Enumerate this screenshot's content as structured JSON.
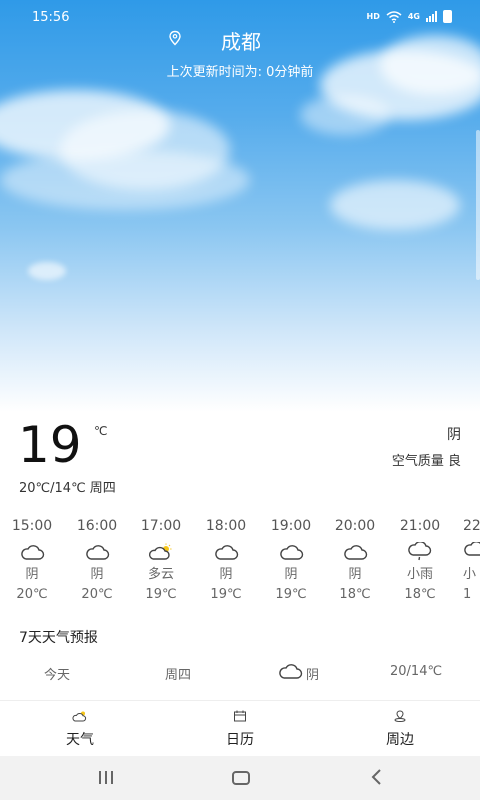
{
  "status": {
    "time": "15:56",
    "hd": "HD",
    "network": "4G"
  },
  "header": {
    "city": "成都",
    "updated": "上次更新时间为: 0分钟前"
  },
  "current": {
    "temp": "19",
    "unit": "℃",
    "condition": "阴",
    "aqi": "空气质量 良",
    "range_day": "20℃/14℃ 周四"
  },
  "hourly": [
    {
      "time": "15:00",
      "icon": "cloudy-icon",
      "cond": "阴",
      "temp": "20℃"
    },
    {
      "time": "16:00",
      "icon": "cloudy-icon",
      "cond": "阴",
      "temp": "20℃"
    },
    {
      "time": "17:00",
      "icon": "partly-cloudy-icon",
      "cond": "多云",
      "temp": "19℃"
    },
    {
      "time": "18:00",
      "icon": "cloudy-icon",
      "cond": "阴",
      "temp": "19℃"
    },
    {
      "time": "19:00",
      "icon": "cloudy-icon",
      "cond": "阴",
      "temp": "19℃"
    },
    {
      "time": "20:00",
      "icon": "cloudy-icon",
      "cond": "阴",
      "temp": "18℃"
    },
    {
      "time": "21:00",
      "icon": "light-rain-icon",
      "cond": "小雨",
      "temp": "18℃"
    },
    {
      "time": "22",
      "icon": "light-rain-icon",
      "cond": "小",
      "temp": "1"
    }
  ],
  "forecast": {
    "title": "7天天气预报",
    "rows": [
      {
        "day": "今天",
        "week": "周四",
        "icon": "cloudy-icon",
        "cond": "阴",
        "temp": "20/14℃"
      }
    ]
  },
  "nav": {
    "items": [
      {
        "label": "天气",
        "icon": "weather-icon"
      },
      {
        "label": "日历",
        "icon": "calendar-icon"
      },
      {
        "label": "周边",
        "icon": "nearby-icon"
      }
    ]
  },
  "colors": {
    "sky_top": "#2f9ae8",
    "sun": "#f5c518"
  }
}
